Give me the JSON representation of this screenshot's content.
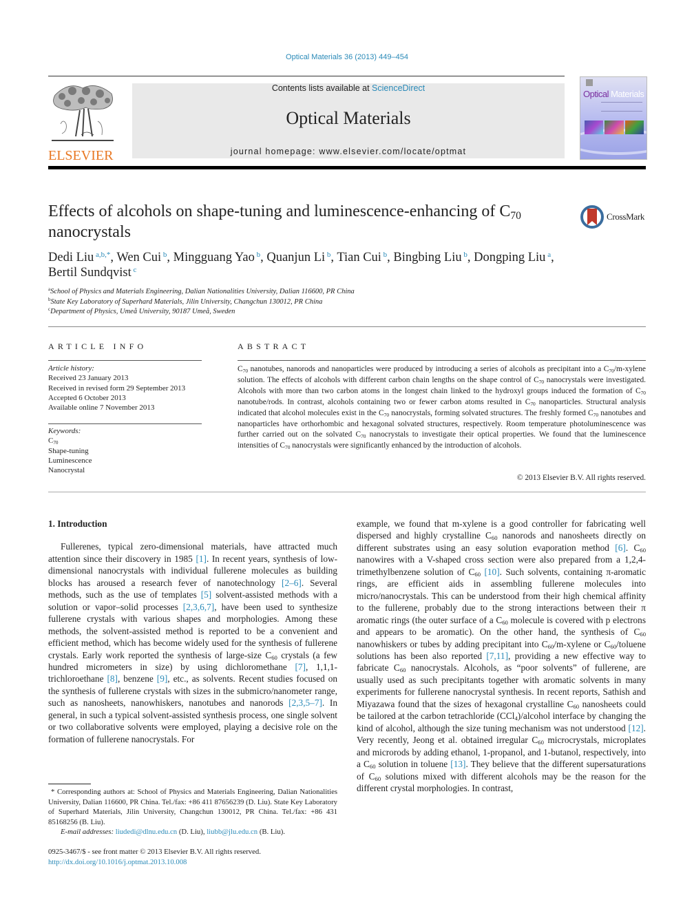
{
  "running_head": "Optical Materials 36 (2013) 449–454",
  "publisher": {
    "logo_text": "ELSEVIER",
    "logo_color": "#e87722",
    "link_color": "#2a8ab8"
  },
  "banner": {
    "contents_prefix": "Contents lists available at ",
    "contents_link": "ScienceDirect",
    "journal_title": "Optical Materials",
    "homepage": "journal homepage: www.elsevier.com/locate/optmat"
  },
  "cover": {
    "title_part1": "Optical",
    "title_part2": "Materials"
  },
  "crossmark": {
    "label": "CrossMark"
  },
  "article": {
    "title_line1": "Effects of alcohols on shape-tuning and luminescence-enhancing of C",
    "title_sub": "70",
    "title_line2": "nanocrystals",
    "authors": [
      {
        "name": "Dedi Liu",
        "sup": "a,b,*",
        "sep": ", "
      },
      {
        "name": "Wen Cui",
        "sup": "b",
        "sep": ", "
      },
      {
        "name": "Mingguang Yao",
        "sup": "b",
        "sep": ", "
      },
      {
        "name": "Quanjun Li",
        "sup": "b",
        "sep": ", "
      },
      {
        "name": "Tian Cui",
        "sup": "b",
        "sep": ", "
      },
      {
        "name": "Bingbing Liu",
        "sup": "b",
        "sep": ", "
      },
      {
        "name": "Dongping Liu",
        "sup": "a",
        "sep": ","
      },
      {
        "name": "Bertil Sundqvist",
        "sup": "c",
        "sep": ""
      }
    ],
    "affiliations": [
      {
        "key": "a",
        "text": "School of Physics and Materials Engineering, Dalian Nationalities University, Dalian 116600, PR China"
      },
      {
        "key": "b",
        "text": "State Key Laboratory of Superhard Materials, Jilin University, Changchun 130012, PR China"
      },
      {
        "key": "c",
        "text": "Department of Physics, Umeå University, 90187 Umeå, Sweden"
      }
    ]
  },
  "article_info": {
    "heading": "ARTICLE INFO",
    "history_label": "Article history:",
    "history": [
      "Received 23 January 2013",
      "Received in revised form 29 September 2013",
      "Accepted 6 October 2013",
      "Available online 7 November 2013"
    ],
    "keywords_label": "Keywords:",
    "keyword_c70_base": "C",
    "keyword_c70_sub": "70",
    "keywords": [
      "Shape-tuning",
      "Luminescence",
      "Nanocrystal"
    ]
  },
  "abstract": {
    "heading": "ABSTRACT",
    "segments": [
      {
        "t": "C"
      },
      {
        "s": "70"
      },
      {
        "t": " nanotubes, nanorods and nanoparticles were produced by introducing a series of alcohols as precipitant into a C"
      },
      {
        "s": "70"
      },
      {
        "t": "/m-xylene solution. The effects of alcohols with different carbon chain lengths on the shape control of C"
      },
      {
        "s": "70"
      },
      {
        "t": " nanocrystals were investigated. Alcohols with more than two carbon atoms in the longest chain linked to the hydroxyl groups induced the formation of C"
      },
      {
        "s": "70"
      },
      {
        "t": " nanotube/rods. In contrast, alcohols containing two or fewer carbon atoms resulted in C"
      },
      {
        "s": "70"
      },
      {
        "t": " nanoparticles. Structural analysis indicated that alcohol molecules exist in the C"
      },
      {
        "s": "70"
      },
      {
        "t": " nanocrystals, forming solvated structures. The freshly formed C"
      },
      {
        "s": "70"
      },
      {
        "t": " nanotubes and nanoparticles have orthorhombic and hexagonal solvated structures, respectively. Room temperature photoluminescence was further carried out on the solvated C"
      },
      {
        "s": "70"
      },
      {
        "t": " nanocrystals to investigate their optical properties. We found that the luminescence intensities of C"
      },
      {
        "s": "70"
      },
      {
        "t": " nanocrystals were significantly enhanced by the introduction of alcohols."
      }
    ],
    "copyright": "© 2013 Elsevier B.V. All rights reserved."
  },
  "introduction": {
    "heading": "1. Introduction",
    "left_segments": [
      {
        "t": "Fullerenes, typical zero-dimensional materials, have attracted much attention since their discovery in 1985 "
      },
      {
        "r": "[1]"
      },
      {
        "t": ". In recent years, synthesis of low-dimensional nanocrystals with individual fullerene molecules as building blocks has aroused a research fever of nanotechnology "
      },
      {
        "r": "[2–6]"
      },
      {
        "t": ". Several methods, such as the use of templates "
      },
      {
        "r": "[5]"
      },
      {
        "t": " solvent-assisted methods with a solution or vapor–solid processes "
      },
      {
        "r": "[2,3,6,7]"
      },
      {
        "t": ", have been used to synthesize fullerene crystals with various shapes and morphologies. Among these methods, the solvent-assisted method is reported to be a convenient and efficient method, which has become widely used for the synthesis of fullerene crystals. Early work reported the synthesis of large-size C"
      },
      {
        "s": "60"
      },
      {
        "t": " crystals (a few hundred micrometers in size) by using dichloromethane "
      },
      {
        "r": "[7]"
      },
      {
        "t": ", 1,1,1-trichloroethane "
      },
      {
        "r": "[8]"
      },
      {
        "t": ", benzene "
      },
      {
        "r": "[9]"
      },
      {
        "t": ", etc., as solvents. Recent studies focused on the synthesis of fullerene crystals with sizes in the submicro/nanometer range, such as nanosheets, nanowhiskers, nanotubes and nanorods "
      },
      {
        "r": "[2,3,5–7]"
      },
      {
        "t": ". In general, in such a typical solvent-assisted synthesis process, one single solvent or two collaborative solvents were employed, playing a decisive role on the formation of fullerene nanocrystals. For"
      }
    ],
    "right_segments": [
      {
        "t": "example, we found that m-xylene is a good controller for fabricating well dispersed and highly crystalline C"
      },
      {
        "s": "60"
      },
      {
        "t": " nanorods and nanosheets directly on different substrates using an easy solution evaporation method "
      },
      {
        "r": "[6]"
      },
      {
        "t": ". C"
      },
      {
        "s": "60"
      },
      {
        "t": " nanowires with a V-shaped cross section were also prepared from a 1,2,4-trimethylbenzene solution of C"
      },
      {
        "s": "60"
      },
      {
        "t": " "
      },
      {
        "r": "[10]"
      },
      {
        "t": ". Such solvents, containing π-aromatic rings, are efficient aids in assembling fullerene molecules into micro/nanocrystals. This can be understood from their high chemical affinity to the fullerene, probably due to the strong interactions between their π aromatic rings (the outer surface of a C"
      },
      {
        "s": "60"
      },
      {
        "t": " molecule is covered with p electrons and appears to be aromatic). On the other hand, the synthesis of C"
      },
      {
        "s": "60"
      },
      {
        "t": " nanowhiskers or tubes by adding precipitant into C"
      },
      {
        "s": "60"
      },
      {
        "t": "/m-xylene or C"
      },
      {
        "s": "60"
      },
      {
        "t": "/toluene solutions has been also reported "
      },
      {
        "r": "[7,11]"
      },
      {
        "t": ", providing a new effective way to fabricate C"
      },
      {
        "s": "60"
      },
      {
        "t": " nanocrystals. Alcohols, as “poor solvents” of fullerene, are usually used as such precipitants together with aromatic solvents in many experiments for fullerene nanocrystal synthesis. In recent reports, Sathish and Miyazawa found that the sizes of hexagonal crystalline C"
      },
      {
        "s": "60"
      },
      {
        "t": " nanosheets could be tailored at the carbon tetrachloride (CCl"
      },
      {
        "s": "4"
      },
      {
        "t": ")/alcohol interface by changing the kind of alcohol, although the size tuning mechanism was not understood "
      },
      {
        "r": "[12]"
      },
      {
        "t": ". Very recently, Jeong et al. obtained irregular C"
      },
      {
        "s": "60"
      },
      {
        "t": " microcrystals, microplates and microrods by adding ethanol, 1-propanol, and 1-butanol, respectively, into a C"
      },
      {
        "s": "60"
      },
      {
        "t": " solution in toluene "
      },
      {
        "r": "[13]"
      },
      {
        "t": ". They believe that the different supersaturations of C"
      },
      {
        "s": "60"
      },
      {
        "t": " solutions mixed with different alcohols may be the reason for the different crystal morphologies. In contrast,"
      }
    ]
  },
  "footnote": {
    "corresponding": "* Corresponding authors at: School of Physics and Materials Engineering, Dalian Nationalities University, Dalian 116600, PR China. Tel./fax: +86 411 87656239 (D. Liu). State Key Laboratory of Superhard Materials, Jilin University, Changchun 130012, PR China. Tel./fax: +86 431 85168256 (B. Liu).",
    "email_label": "E-mail addresses:",
    "email1": "liudedi@dlnu.edu.cn",
    "email1_owner": " (D. Liu), ",
    "email2": "liubb@jlu.edu.cn",
    "email2_owner": " (B. Liu)."
  },
  "footer": {
    "issn_line": "0925-3467/$ - see front matter © 2013 Elsevier B.V. All rights reserved.",
    "doi": "http://dx.doi.org/10.1016/j.optmat.2013.10.008"
  }
}
